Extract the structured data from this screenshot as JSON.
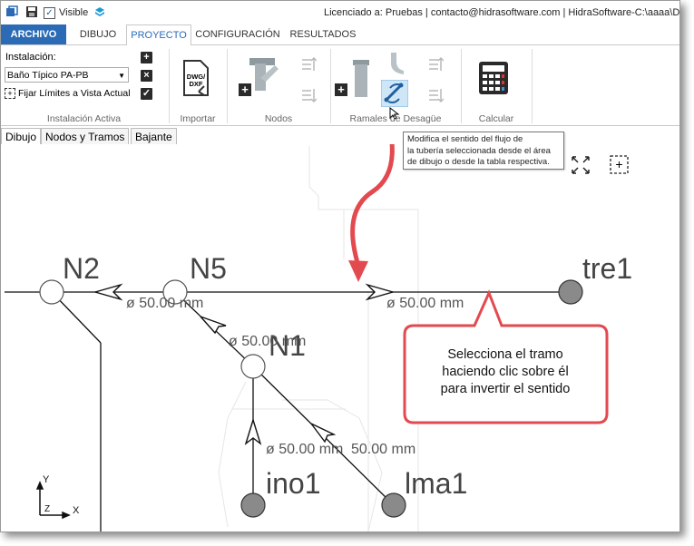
{
  "window": {
    "title": "Licenciado a: Pruebas | contacto@hidrasoftware.com | HidraSoftware-C:\\aaaa\\Desague",
    "visible_label": "Visible",
    "visible_checked": true
  },
  "tabs": [
    {
      "label": "ARCHIVO"
    },
    {
      "label": "DIBUJO"
    },
    {
      "label": "PROYECTO",
      "active": true
    },
    {
      "label": "CONFIGURACIÓN"
    },
    {
      "label": "RESULTADOS"
    }
  ],
  "ribbon": {
    "instalacion_label": "Instalación:",
    "instalacion_value": "Baño Típico PA-PB",
    "fijar_label": "Fijar Límites a Vista Actual",
    "groups": {
      "instalacion_activa": "Instalación Activa",
      "importar": "Importar",
      "nodos": "Nodos",
      "ramales": "Ramales de Desagüe",
      "calcular": "Calcular"
    },
    "dwg_icon_text": "DWG/ DXF"
  },
  "doc_tabs": [
    {
      "label": "Dibujo",
      "active": true
    },
    {
      "label": "Nodos y Tramos"
    },
    {
      "label": "Bajante"
    }
  ],
  "tooltip": {
    "lines": [
      "Modifica el sentido del flujo de",
      "la tubería seleccionada desde el área",
      "de dibujo o desde la tabla respectiva."
    ]
  },
  "drawing": {
    "nodes": {
      "n2": "N2",
      "n5": "N5",
      "n1": "N1",
      "tre1": "tre1",
      "ino1": "ino1",
      "lma1": "lma1"
    },
    "pipe_labels": {
      "left": "ø 50.00 mm",
      "right": "ø 50.00 mm",
      "diag": "ø 50.00 mm",
      "ino": "ø 50.00 mm",
      "lma": "50.00 mm"
    },
    "axis": {
      "y": "Y",
      "x": "X",
      "z": "Z"
    }
  },
  "callout": {
    "lines": [
      "Selecciona el tramo",
      "haciendo clic sobre él",
      "para invertir el sentido"
    ],
    "color": "#e24a4f"
  },
  "colors": {
    "accent": "#2b6bb6",
    "selected_node": "#8a8a8a"
  }
}
